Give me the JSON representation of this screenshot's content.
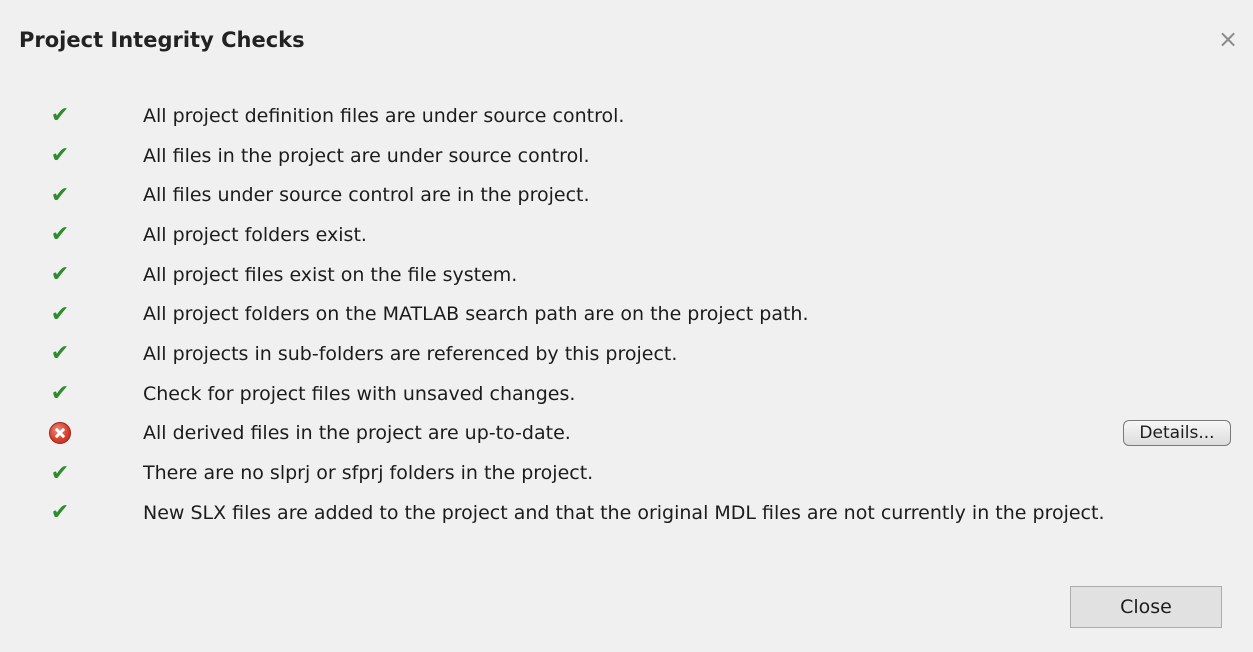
{
  "window": {
    "title": "Project Integrity Checks",
    "close_glyph": "×"
  },
  "checks": [
    {
      "status": "pass",
      "icon": "checkmark-icon",
      "glyph": "✔",
      "text": "All project definition files are under source control."
    },
    {
      "status": "pass",
      "icon": "checkmark-icon",
      "glyph": "✔",
      "text": "All files in the project are under source control."
    },
    {
      "status": "pass",
      "icon": "checkmark-icon",
      "glyph": "✔",
      "text": "All files under source control are in the project."
    },
    {
      "status": "pass",
      "icon": "checkmark-icon",
      "glyph": "✔",
      "text": "All project folders exist."
    },
    {
      "status": "pass",
      "icon": "checkmark-icon",
      "glyph": "✔",
      "text": "All project files exist on the file system."
    },
    {
      "status": "pass",
      "icon": "checkmark-icon",
      "glyph": "✔",
      "text": "All project folders on the MATLAB search path are on the project path."
    },
    {
      "status": "pass",
      "icon": "checkmark-icon",
      "glyph": "✔",
      "text": "All projects in sub-folders are referenced by this project."
    },
    {
      "status": "pass",
      "icon": "checkmark-icon",
      "glyph": "✔",
      "text": "Check for project files with unsaved changes."
    },
    {
      "status": "fail",
      "icon": "error-icon",
      "glyph": "",
      "text": "All derived files in the project are up-to-date.",
      "action_label": "Details..."
    },
    {
      "status": "pass",
      "icon": "checkmark-icon",
      "glyph": "✔",
      "text": "There are no slprj or sfprj folders in the project."
    },
    {
      "status": "pass",
      "icon": "checkmark-icon",
      "glyph": "✔",
      "text": "New SLX files are added to the project and that the original MDL files are not currently in the project."
    }
  ],
  "footer": {
    "close_label": "Close"
  },
  "colors": {
    "pass": "#2e8b2e",
    "fail": "#d7412f",
    "background": "#f0f0f0"
  }
}
